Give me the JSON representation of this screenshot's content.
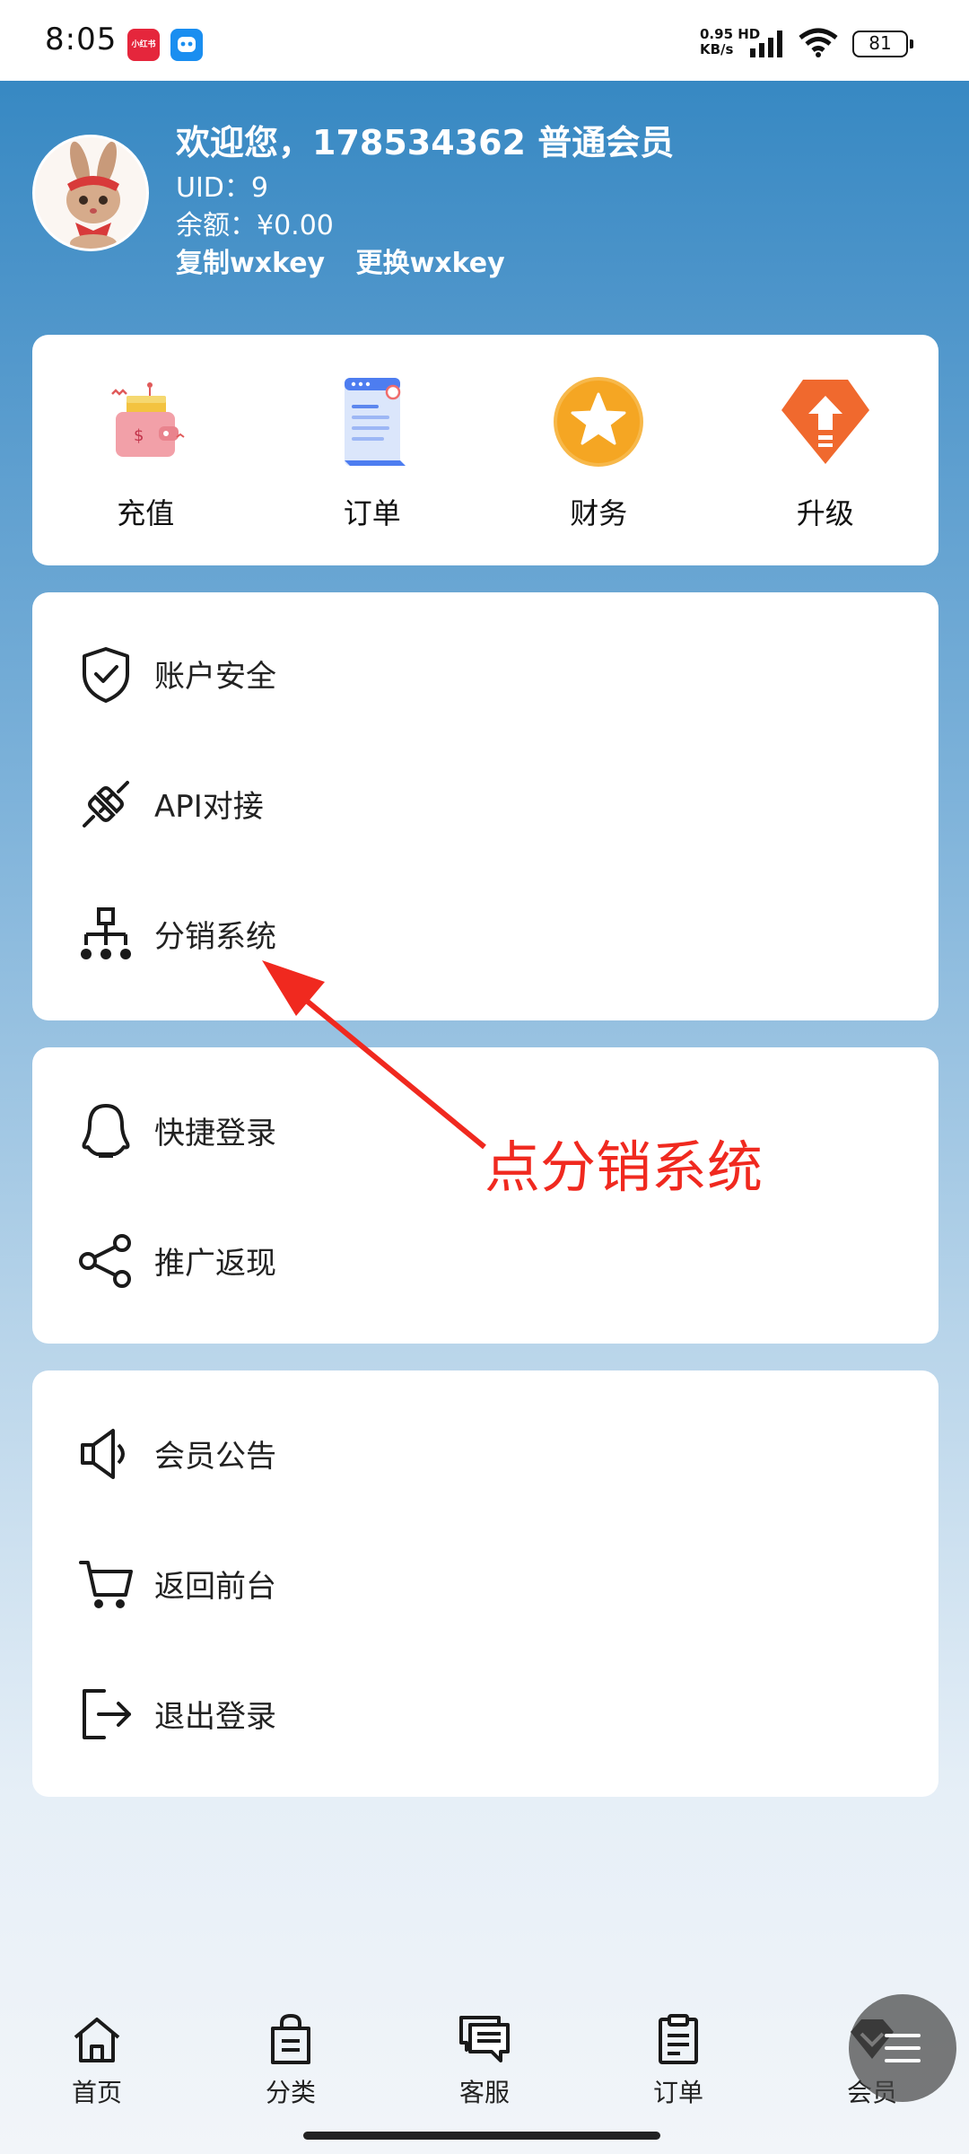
{
  "status_bar": {
    "time": "8:05",
    "app1_label": "小红书",
    "net_speed_top": "0.95 HD",
    "net_speed_bottom": "KB/s",
    "battery": "81"
  },
  "profile": {
    "greeting": "欢迎您，178534362 普通会员",
    "uid": "UID：9",
    "balance": "余额：¥0.00",
    "copy_key": "复制wxkey",
    "change_key": "更换wxkey"
  },
  "quick_actions": [
    {
      "label": "充值",
      "icon": "wallet-icon"
    },
    {
      "label": "订单",
      "icon": "document-icon"
    },
    {
      "label": "财务",
      "icon": "star-icon"
    },
    {
      "label": "升级",
      "icon": "upgrade-icon"
    }
  ],
  "menu_group_1": [
    {
      "label": "账户安全",
      "icon": "shield-check-icon"
    },
    {
      "label": "API对接",
      "icon": "plug-icon"
    },
    {
      "label": "分销系统",
      "icon": "org-chart-icon"
    }
  ],
  "menu_group_2": [
    {
      "label": "快捷登录",
      "icon": "qq-icon"
    },
    {
      "label": "推广返现",
      "icon": "share-icon"
    }
  ],
  "menu_group_3": [
    {
      "label": "会员公告",
      "icon": "speaker-icon"
    },
    {
      "label": "返回前台",
      "icon": "cart-icon"
    },
    {
      "label": "退出登录",
      "icon": "logout-icon"
    }
  ],
  "annotation": {
    "text": "点分销系统",
    "color": "#f0291f"
  },
  "bottom_nav": [
    {
      "label": "首页",
      "icon": "home-icon"
    },
    {
      "label": "分类",
      "icon": "bag-icon"
    },
    {
      "label": "客服",
      "icon": "chat-icon"
    },
    {
      "label": "订单",
      "icon": "clipboard-icon"
    },
    {
      "label": "会员",
      "icon": "member-icon"
    }
  ],
  "colors": {
    "header_blue": "#2f84c0",
    "accent_red": "#f0291f"
  }
}
